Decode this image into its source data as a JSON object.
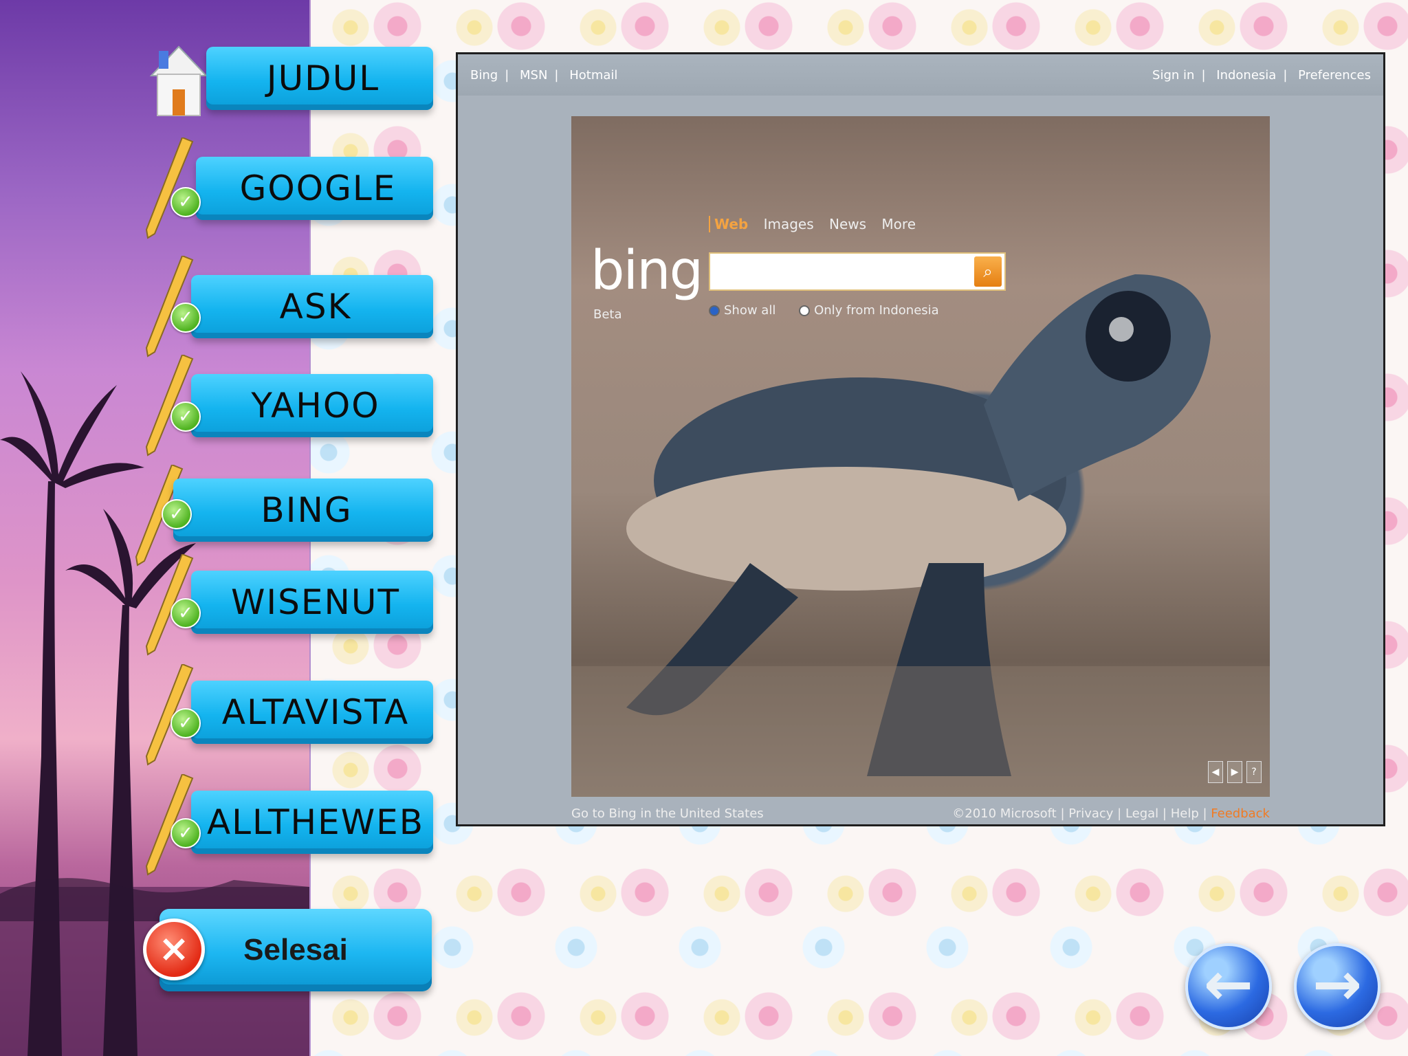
{
  "nav": {
    "items": [
      {
        "label": "JUDUL"
      },
      {
        "label": "GOOGLE"
      },
      {
        "label": "ASK"
      },
      {
        "label": "YAHOO"
      },
      {
        "label": "BING"
      },
      {
        "label": "WISENUT"
      },
      {
        "label": "ALTAVISTA"
      },
      {
        "label": "ALLTHEWEB"
      }
    ],
    "finish_label": "Selesai"
  },
  "screenshot": {
    "topbar_left": [
      "Bing",
      "MSN",
      "Hotmail"
    ],
    "topbar_right": [
      "Sign in",
      "Indonesia",
      "Preferences"
    ],
    "logo": "bing",
    "logo_sub": "Beta",
    "tabs": [
      "Web",
      "Images",
      "News",
      "More"
    ],
    "search_value": "",
    "options": [
      "Show all",
      "Only from Indonesia"
    ],
    "footer_left": "Go to Bing in the United States",
    "footer_right": [
      "©2010 Microsoft",
      "Privacy",
      "Legal",
      "Help",
      "Feedback"
    ]
  },
  "colors": {
    "button_blue": "#14b4ef",
    "check_green": "#4fb321",
    "bing_orange": "#f4a341",
    "close_red": "#e32b15"
  }
}
